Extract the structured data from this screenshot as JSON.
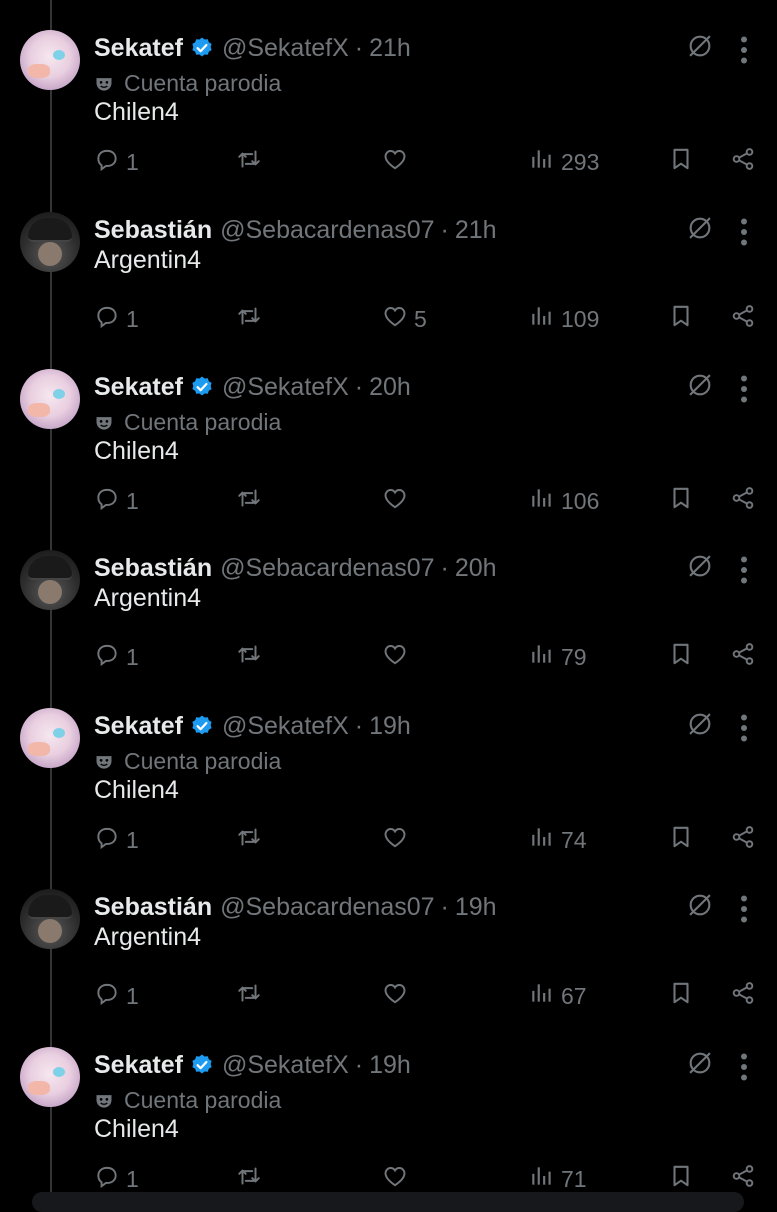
{
  "colors": {
    "background": "#000000",
    "text": "#e7e9ea",
    "muted": "#71767b",
    "verified": "#1d9bf0",
    "thread_line": "#333639"
  },
  "icons": {
    "reply": "reply-icon",
    "retweet": "retweet-icon",
    "like": "heart-icon",
    "views": "views-chart-icon",
    "bookmark": "bookmark-icon",
    "share": "share-icon",
    "grok": "grok-icon",
    "more": "more-vertical-icon",
    "parody": "theater-mask-icon",
    "verified": "verified-badge-icon"
  },
  "tweets": [
    {
      "name": "Sekatef",
      "handle": "@SekatefX",
      "time": "21h",
      "verified": true,
      "parody_label": "Cuenta parodia",
      "text": "Chilen4",
      "replies": "1",
      "retweets": "",
      "likes": "",
      "views": "293"
    },
    {
      "name": "Sebastián",
      "handle": "@Sebacardenas07",
      "time": "21h",
      "verified": false,
      "parody_label": "",
      "text": "Argentin4",
      "replies": "1",
      "retweets": "",
      "likes": "5",
      "views": "109"
    },
    {
      "name": "Sekatef",
      "handle": "@SekatefX",
      "time": "20h",
      "verified": true,
      "parody_label": "Cuenta parodia",
      "text": "Chilen4",
      "replies": "1",
      "retweets": "",
      "likes": "",
      "views": "106"
    },
    {
      "name": "Sebastián",
      "handle": "@Sebacardenas07",
      "time": "20h",
      "verified": false,
      "parody_label": "",
      "text": "Argentin4",
      "replies": "1",
      "retweets": "",
      "likes": "",
      "views": "79"
    },
    {
      "name": "Sekatef",
      "handle": "@SekatefX",
      "time": "19h",
      "verified": true,
      "parody_label": "Cuenta parodia",
      "text": "Chilen4",
      "replies": "1",
      "retweets": "",
      "likes": "",
      "views": "74"
    },
    {
      "name": "Sebastián",
      "handle": "@Sebacardenas07",
      "time": "19h",
      "verified": false,
      "parody_label": "",
      "text": "Argentin4",
      "replies": "1",
      "retweets": "",
      "likes": "",
      "views": "67"
    },
    {
      "name": "Sekatef",
      "handle": "@SekatefX",
      "time": "19h",
      "verified": true,
      "parody_label": "Cuenta parodia",
      "text": "Chilen4",
      "replies": "1",
      "retweets": "",
      "likes": "",
      "views": "71"
    }
  ]
}
